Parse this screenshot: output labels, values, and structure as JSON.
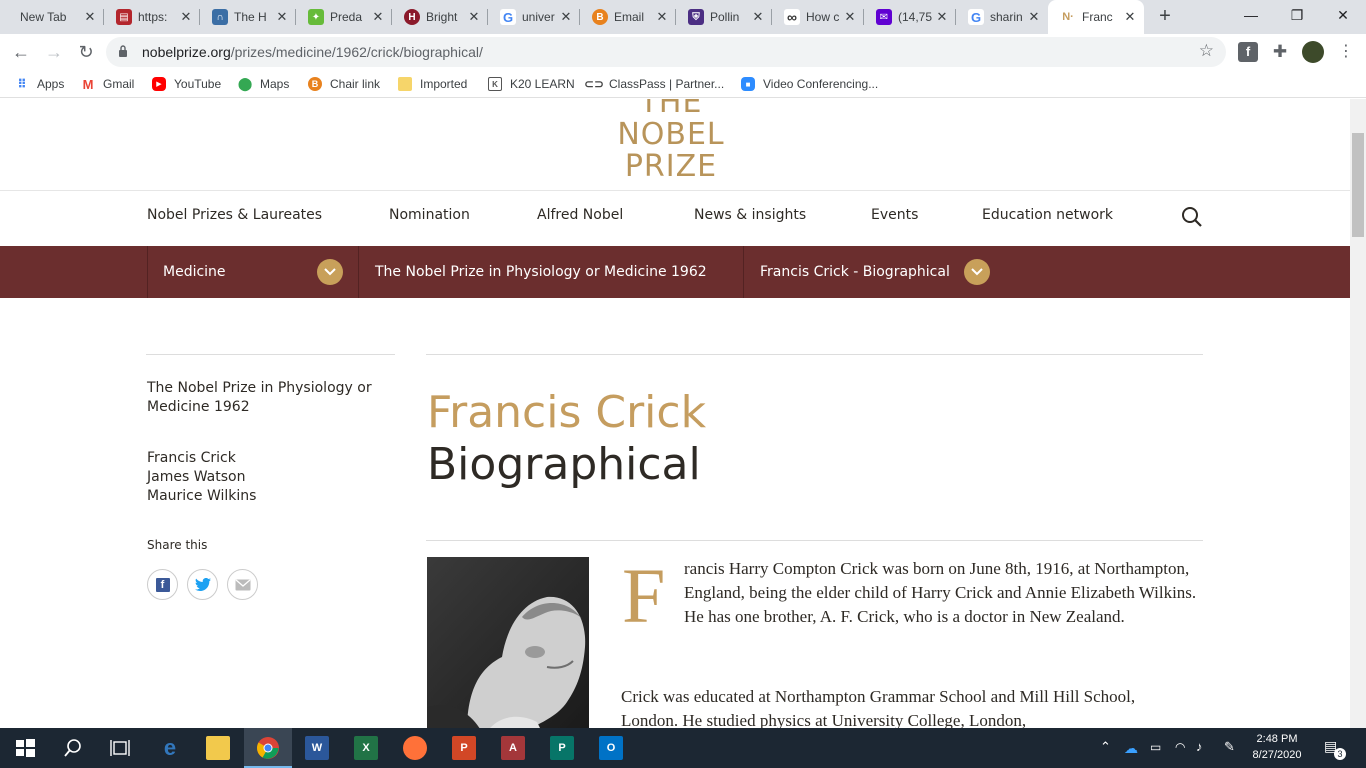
{
  "browser": {
    "tabs": [
      {
        "title": "New Tab",
        "icon": "blank-icon",
        "color": "#dee1e6"
      },
      {
        "title": "https:",
        "icon": "pdf-icon",
        "color": "#b3262d"
      },
      {
        "title": "The H",
        "icon": "arch-icon",
        "color": "#3b6ea5"
      },
      {
        "title": "Preda",
        "icon": "leaf-icon",
        "color": "#66bb3a"
      },
      {
        "title": "Bright",
        "icon": "h-shield-icon",
        "color": "#8b1a2b"
      },
      {
        "title": "univer",
        "icon": "google-icon",
        "color": "#4285f4"
      },
      {
        "title": "Email",
        "icon": "b-circle-icon",
        "color": "#e8821e"
      },
      {
        "title": "Pollin",
        "icon": "shield-icon",
        "color": "#4b2e83"
      },
      {
        "title": "How c",
        "icon": "infinity-icon",
        "color": "#333333"
      },
      {
        "title": "(14,75",
        "icon": "mail-icon",
        "color": "#6001d2"
      },
      {
        "title": "sharin",
        "icon": "google-icon",
        "color": "#4285f4"
      },
      {
        "title": "Franc",
        "icon": "nobel-icon",
        "color": "#c59d5f"
      }
    ],
    "new_tab": "+",
    "window_controls": [
      "—",
      "❐",
      "✕"
    ],
    "url_domain": "nobelprize.org",
    "url_path": "/prizes/medicine/1962/crick/biographical/",
    "bookmarks": [
      {
        "label": "Apps",
        "icon": "apps-grid-icon",
        "color": "#4285f4"
      },
      {
        "label": "Gmail",
        "icon": "gmail-icon",
        "color": "#ea4335"
      },
      {
        "label": "YouTube",
        "icon": "youtube-icon",
        "color": "#ff0000"
      },
      {
        "label": "Maps",
        "icon": "maps-icon",
        "color": "#34a853"
      },
      {
        "label": "Chair link",
        "icon": "b-circle-icon",
        "color": "#e8821e"
      },
      {
        "label": "Imported",
        "icon": "folder-icon",
        "color": "#f6d56a"
      },
      {
        "label": "K20 LEARN",
        "icon": "k20-icon",
        "color": "#555555"
      },
      {
        "label": "ClassPass | Partner...",
        "icon": "link-icon",
        "color": "#444444"
      },
      {
        "label": "Video Conferencing...",
        "icon": "zoom-icon",
        "color": "#2d8cff"
      }
    ]
  },
  "site": {
    "logo_lines": [
      "THE",
      "NOBEL",
      "PRIZE"
    ],
    "nav": [
      "Nobel Prizes & Laureates",
      "Nomination",
      "Alfred Nobel",
      "News & insights",
      "Events",
      "Education network"
    ],
    "breadcrumb": {
      "category": "Medicine",
      "prize": "The Nobel Prize in Physiology or Medicine 1962",
      "page": "Francis Crick - Biographical"
    },
    "sidebar": {
      "prize_link": "The Nobel Prize in Physiology or Medicine 1962",
      "laureates": [
        "Francis Crick",
        "James Watson",
        "Maurice Wilkins"
      ],
      "share_label": "Share this"
    },
    "title_name": "Francis Crick",
    "title_sub": "Biographical",
    "dropcap": "F",
    "para1": "rancis Harry Compton Crick was born on June 8th, 1916, at Northampton, England, being the elder child of Harry Crick and Annie Elizabeth Wilkins. He has one brother, A. F. Crick, who is a doctor in New Zealand.",
    "para2": "Crick was educated at Northampton Grammar School and Mill Hill School, London. He studied physics at University College, London,",
    "accent_color": "#c59d5f",
    "crumb_bg": "#6b2e2e"
  },
  "taskbar": {
    "time": "2:48 PM",
    "date": "8/27/2020",
    "notifications": "3"
  }
}
